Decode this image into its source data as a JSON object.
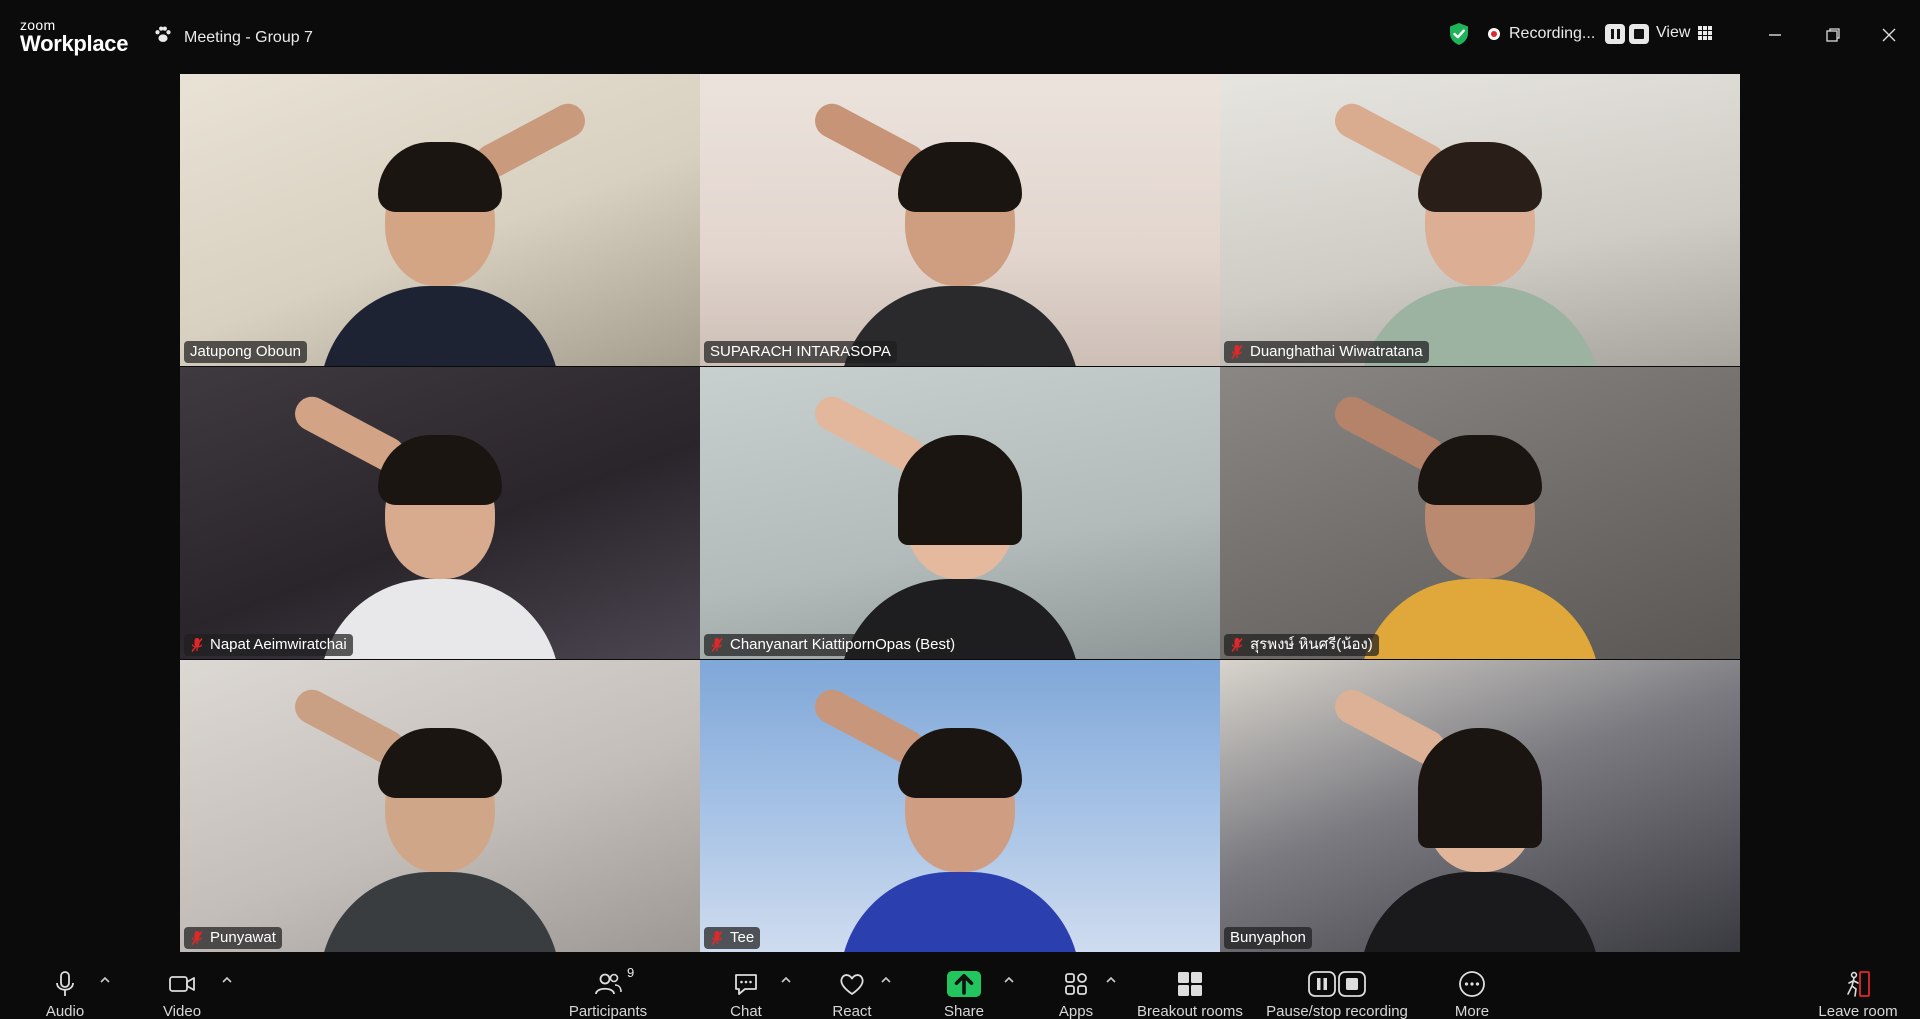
{
  "app": {
    "logo_small": "zoom",
    "logo_big": "Workplace",
    "meeting_title": "Meeting - Group 7"
  },
  "status": {
    "recording_label": "Recording...",
    "view_label": "View"
  },
  "colors": {
    "active_speaker": "#2ecc71",
    "share_green": "#23c55e",
    "recording_red": "#e02828",
    "mute_red": "#e02828"
  },
  "participants": [
    {
      "name": "Jatupong Oboun",
      "muted": false,
      "active": false
    },
    {
      "name": "SUPARACH INTARASOPA",
      "muted": false,
      "active": true
    },
    {
      "name": "Duanghathai Wiwatratana",
      "muted": true,
      "active": false
    },
    {
      "name": "Napat Aeimwiratchai",
      "muted": true,
      "active": false
    },
    {
      "name": "Chanyanart KiattipornOpas (Best)",
      "muted": true,
      "active": false
    },
    {
      "name": "สุรพงษ์ หินศรี(น้อง)",
      "muted": true,
      "active": false
    },
    {
      "name": "Punyawat",
      "muted": true,
      "active": false
    },
    {
      "name": "Tee",
      "muted": true,
      "active": false
    },
    {
      "name": "Bunyaphon",
      "muted": false,
      "active": false
    }
  ],
  "toolbar": {
    "audio": "Audio",
    "video": "Video",
    "participants": "Participants",
    "participants_count": "9",
    "chat": "Chat",
    "react": "React",
    "share": "Share",
    "apps": "Apps",
    "breakout": "Breakout rooms",
    "pause_stop": "Pause/stop recording",
    "more": "More",
    "leave": "Leave room"
  }
}
